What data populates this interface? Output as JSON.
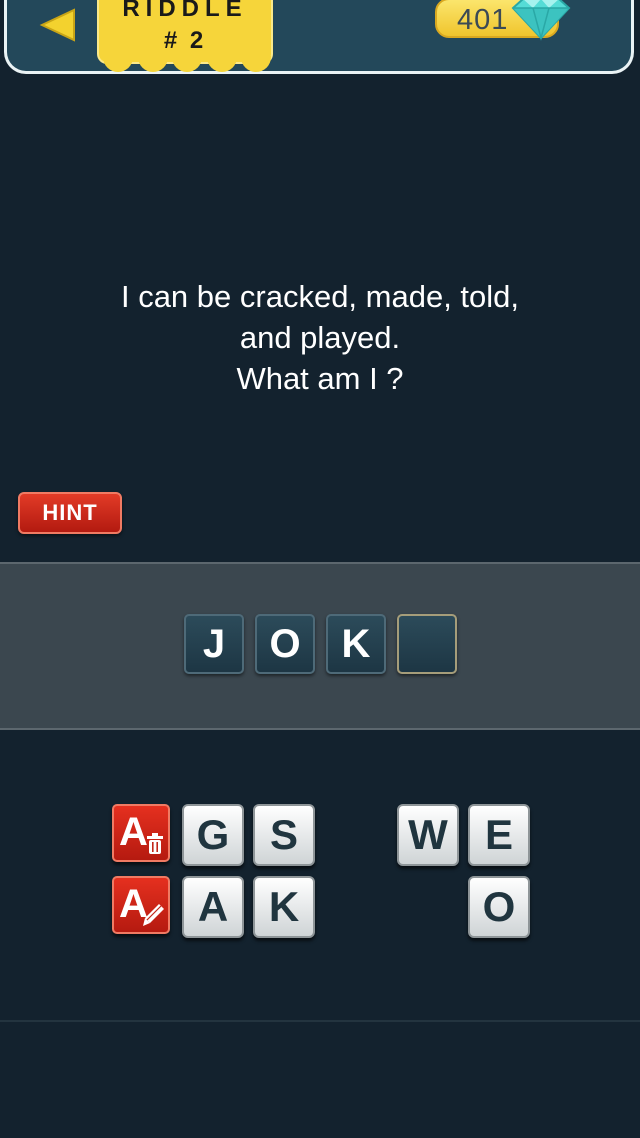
{
  "header": {
    "riddle_word": "RIDDLE",
    "riddle_number": "# 2",
    "gem_count": "401"
  },
  "question": {
    "line1": "I can be cracked, made, told,",
    "line2": "and played.",
    "line3": "What am I ?"
  },
  "hint_label": "HINT",
  "answer_slots": [
    "J",
    "O",
    "K",
    ""
  ],
  "letters": {
    "g": "G",
    "s": "S",
    "w": "W",
    "e": "E",
    "a": "A",
    "k": "K",
    "o": "O"
  },
  "power_ups": {
    "remove_letter": "A",
    "reveal_letter": "A"
  },
  "colors": {
    "background": "#13222e",
    "header": "#23485a",
    "riddle_tag": "#f6d53a",
    "hint_red": "#d32a1c",
    "gem_cyan": "#4fd8d4"
  }
}
